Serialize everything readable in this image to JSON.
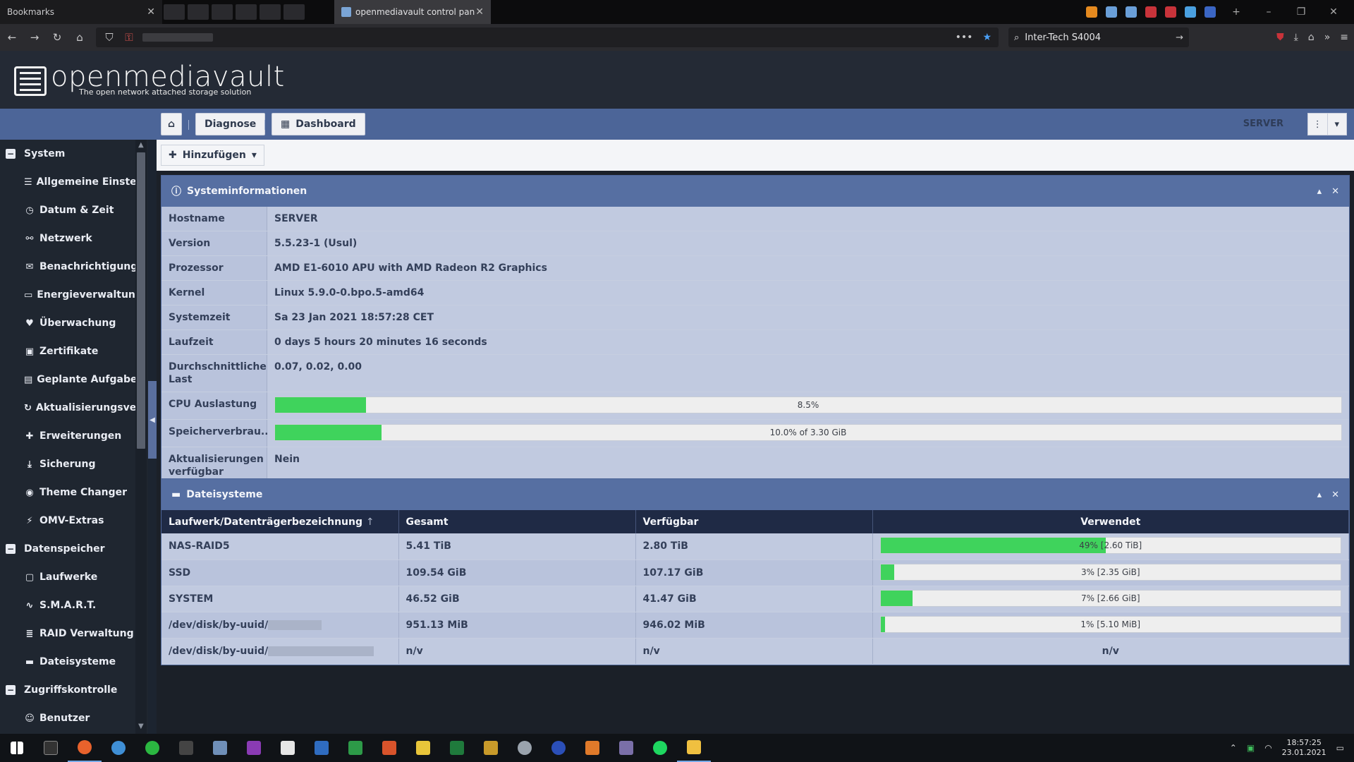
{
  "browser": {
    "bookmarks_tab": "Bookmarks",
    "active_tab": "openmediavault control panel",
    "search_value": "Inter-Tech S4004"
  },
  "app": {
    "brand": "openmediavault",
    "tagline": "The open network attached storage solution"
  },
  "toolbar": {
    "breadcrumb": [
      "Diagnose",
      "Dashboard"
    ],
    "server": "SERVER",
    "add_label": "Hinzufügen"
  },
  "sidebar": {
    "groups": [
      {
        "label": "System",
        "items": [
          {
            "label": "Allgemeine Einstellungen",
            "icon": "sliders-icon"
          },
          {
            "label": "Datum & Zeit",
            "icon": "clock-icon"
          },
          {
            "label": "Netzwerk",
            "icon": "network-icon"
          },
          {
            "label": "Benachrichtigung",
            "icon": "envelope-icon"
          },
          {
            "label": "Energieverwaltung",
            "icon": "battery-icon"
          },
          {
            "label": "Überwachung",
            "icon": "heartbeat-icon"
          },
          {
            "label": "Zertifikate",
            "icon": "certificate-icon"
          },
          {
            "label": "Geplante Aufgaben",
            "icon": "calendar-icon"
          },
          {
            "label": "Aktualisierungsverwaltung",
            "icon": "refresh-icon"
          },
          {
            "label": "Erweiterungen",
            "icon": "puzzle-icon"
          },
          {
            "label": "Sicherung",
            "icon": "download-icon"
          },
          {
            "label": "Theme Changer",
            "icon": "palette-icon"
          },
          {
            "label": "OMV-Extras",
            "icon": "plug-icon"
          }
        ]
      },
      {
        "label": "Datenspeicher",
        "items": [
          {
            "label": "Laufwerke",
            "icon": "disk-icon"
          },
          {
            "label": "S.M.A.R.T.",
            "icon": "pulse-icon"
          },
          {
            "label": "RAID Verwaltung",
            "icon": "database-icon"
          },
          {
            "label": "Dateisysteme",
            "icon": "folder-icon"
          }
        ]
      },
      {
        "label": "Zugriffskontrolle",
        "items": [
          {
            "label": "Benutzer",
            "icon": "user-icon"
          }
        ]
      }
    ]
  },
  "sysinfo": {
    "title": "Systeminformationen",
    "rows": [
      {
        "key": "Hostname",
        "value": "SERVER"
      },
      {
        "key": "Version",
        "value": "5.5.23-1 (Usul)"
      },
      {
        "key": "Prozessor",
        "value": "AMD E1-6010 APU with AMD Radeon R2 Graphics"
      },
      {
        "key": "Kernel",
        "value": "Linux 5.9.0-0.bpo.5-amd64"
      },
      {
        "key": "Systemzeit",
        "value": "Sa 23 Jan 2021 18:57:28 CET"
      },
      {
        "key": "Laufzeit",
        "value": "0 days 5 hours 20 minutes 16 seconds"
      },
      {
        "key": "Durchschnittliche Last",
        "value": "0.07, 0.02, 0.00"
      }
    ],
    "cpu": {
      "key": "CPU Auslastung",
      "label": "8.5%",
      "fraction": 0.085
    },
    "mem": {
      "key": "Speicherverbrau...",
      "label": "10.0% of 3.30 GiB",
      "fraction": 0.1
    },
    "updates": {
      "key": "Aktualisierungen verfügbar",
      "value": "Nein"
    }
  },
  "filesystems": {
    "title": "Dateisysteme",
    "headers": [
      "Laufwerk/Datenträgerbezeichnung",
      "Gesamt",
      "Verfügbar",
      "Verwendet"
    ],
    "sort_indicator": "↑",
    "rows": [
      {
        "name": "NAS-RAID5",
        "total": "5.41 TiB",
        "free": "2.80 TiB",
        "used_label": "49% [2.60 TiB]",
        "used_fraction": 0.49
      },
      {
        "name": "SSD",
        "total": "109.54 GiB",
        "free": "107.17 GiB",
        "used_label": "3% [2.35 GiB]",
        "used_fraction": 0.03
      },
      {
        "name": "SYSTEM",
        "total": "46.52 GiB",
        "free": "41.47 GiB",
        "used_label": "7% [2.66 GiB]",
        "used_fraction": 0.07
      },
      {
        "name": "/dev/disk/by-uuid/",
        "total": "951.13 MiB",
        "free": "946.02 MiB",
        "used_label": "1% [5.10 MiB]",
        "used_fraction": 0.01
      },
      {
        "name": "/dev/disk/by-uuid/",
        "total": "n/v",
        "free": "n/v",
        "used_label": "n/v",
        "used_fraction": null
      }
    ]
  },
  "taskbar": {
    "time": "18:57:25",
    "date": "23.01.2021"
  }
}
